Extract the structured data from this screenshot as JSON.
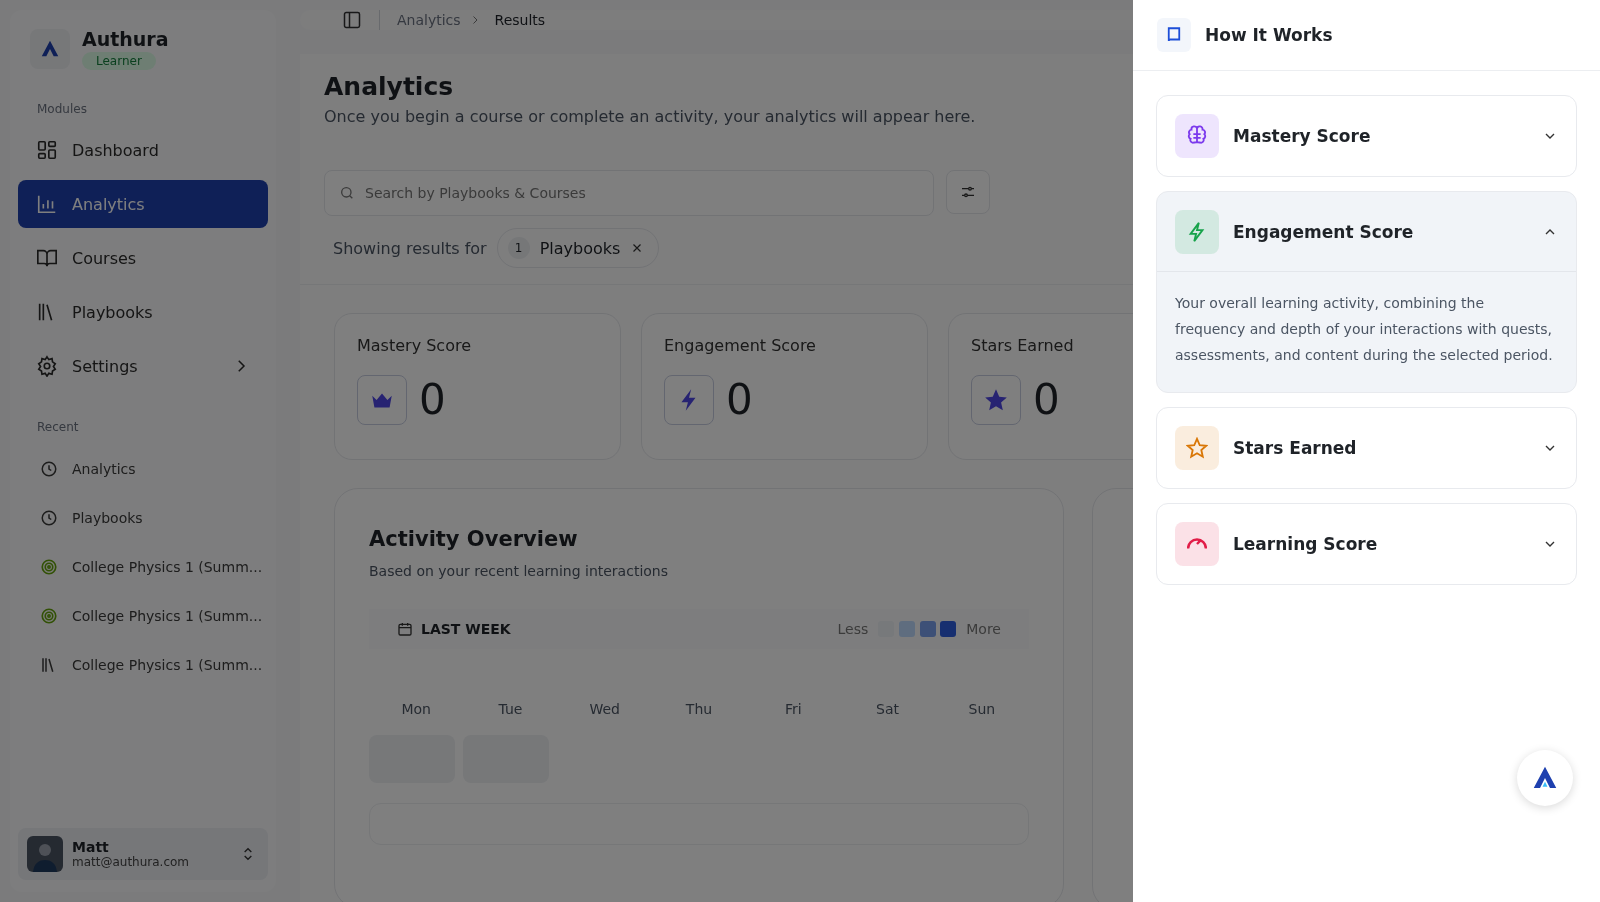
{
  "brand": {
    "name": "Authura",
    "role": "Learner"
  },
  "sidebar": {
    "modules_heading": "Modules",
    "items": [
      {
        "label": "Dashboard",
        "kind": "grid",
        "selected": false,
        "submenu": false
      },
      {
        "label": "Analytics",
        "kind": "chart",
        "selected": true,
        "submenu": false
      },
      {
        "label": "Courses",
        "kind": "book",
        "selected": false,
        "submenu": false
      },
      {
        "label": "Playbooks",
        "kind": "books",
        "selected": false,
        "submenu": false
      },
      {
        "label": "Settings",
        "kind": "gear",
        "selected": false,
        "submenu": true
      }
    ],
    "recent_heading": "Recent",
    "recent": [
      {
        "label": "Analytics",
        "kind": "clock"
      },
      {
        "label": "Playbooks",
        "kind": "clock"
      },
      {
        "label": "College Physics 1 (Summ...",
        "kind": "target"
      },
      {
        "label": "College Physics 1 (Summ...",
        "kind": "target"
      },
      {
        "label": "College Physics 1 (Summ...",
        "kind": "books"
      }
    ],
    "user": {
      "name": "Matt",
      "email": "matt@authura.com"
    }
  },
  "breadcrumb": [
    {
      "label": "Analytics",
      "current": false
    },
    {
      "label": "Results",
      "current": true
    }
  ],
  "page": {
    "title": "Analytics",
    "subtitle": "Once you begin a course or complete an activity, your analytics will appear here."
  },
  "search": {
    "placeholder": "Search by Playbooks & Courses"
  },
  "filter": {
    "prefix": "Showing results for",
    "count": "1",
    "label": "Playbooks"
  },
  "stats": [
    {
      "label": "Mastery Score",
      "value": "0",
      "kind": "crown"
    },
    {
      "label": "Engagement Score",
      "value": "0",
      "kind": "bolt"
    },
    {
      "label": "Stars Earned",
      "value": "0",
      "kind": "star"
    }
  ],
  "activity": {
    "title": "Activity Overview",
    "subtitle": "Based on your recent learning interactions",
    "range": "LAST WEEK",
    "less": "Less",
    "more": "More",
    "days": [
      "Mon",
      "Tue",
      "Wed",
      "Thu",
      "Fri",
      "Sat",
      "Sun"
    ]
  },
  "drawer": {
    "title": "How It Works",
    "items": [
      {
        "title": "Mastery Score",
        "kind": "brain",
        "color": "#7c3aed",
        "expanded": false
      },
      {
        "title": "Engagement Score",
        "kind": "bolt",
        "color": "#16a34a",
        "expanded": true,
        "body": "Your overall learning activity, combining the frequency and depth of your interactions with quests, assessments, and content during the selected period."
      },
      {
        "title": "Stars Earned",
        "kind": "star",
        "color": "#d97706",
        "expanded": false
      },
      {
        "title": "Learning Score",
        "kind": "gauge",
        "color": "#e11d48",
        "expanded": false
      }
    ]
  }
}
